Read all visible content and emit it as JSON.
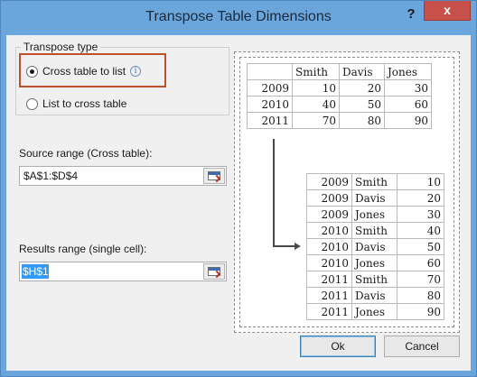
{
  "window": {
    "title": "Transpose Table Dimensions",
    "help_label": "?",
    "close_label": "x",
    "accent_color": "#6aa6dc"
  },
  "transpose_type": {
    "legend": "Transpose type",
    "option_cross_to_list": "Cross table to list",
    "option_list_to_cross": "List to cross table",
    "selected": "Cross table to list",
    "info_icon_glyph": "i",
    "highlight_color": "#c0502a"
  },
  "source_range": {
    "label": "Source range (Cross table):",
    "value": "$A$1:$D$4",
    "picker_icon": "range-picker-icon"
  },
  "results_range": {
    "label": "Results range (single cell):",
    "value": "$H$1",
    "picker_icon": "range-picker-icon"
  },
  "preview": {
    "cross_table": {
      "header": [
        "",
        "Smith",
        "Davis",
        "Jones"
      ],
      "rows": [
        [
          "2009",
          "10",
          "20",
          "30"
        ],
        [
          "2010",
          "40",
          "50",
          "60"
        ],
        [
          "2011",
          "70",
          "80",
          "90"
        ]
      ]
    },
    "list_table": {
      "rows": [
        [
          "2009",
          "Smith",
          "10"
        ],
        [
          "2009",
          "Davis",
          "20"
        ],
        [
          "2009",
          "Jones",
          "30"
        ],
        [
          "2010",
          "Smith",
          "40"
        ],
        [
          "2010",
          "Davis",
          "50"
        ],
        [
          "2010",
          "Jones",
          "60"
        ],
        [
          "2011",
          "Smith",
          "70"
        ],
        [
          "2011",
          "Davis",
          "80"
        ],
        [
          "2011",
          "Jones",
          "90"
        ]
      ]
    }
  },
  "buttons": {
    "ok": "Ok",
    "cancel": "Cancel"
  }
}
